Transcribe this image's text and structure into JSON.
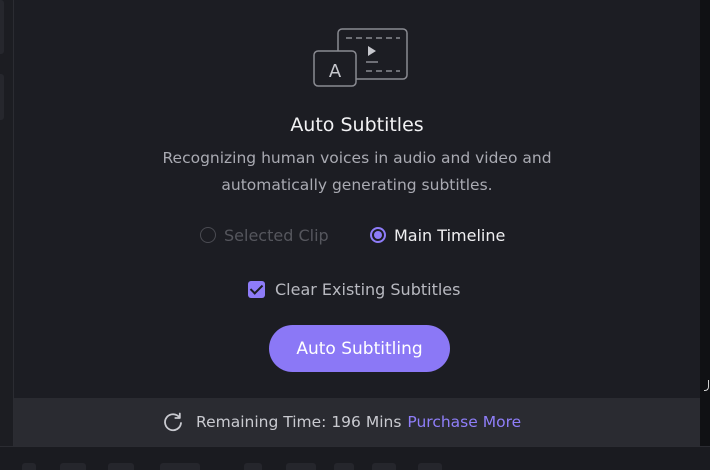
{
  "auto_subtitles": {
    "title": "Auto Subtitles",
    "description_line1": "Recognizing human voices in audio and video and",
    "description_line2": "automatically generating subtitles.",
    "options": {
      "selected_clip_label": "Selected Clip",
      "main_timeline_label": "Main Timeline",
      "selected": "Main Timeline"
    },
    "clear_existing": {
      "label": "Clear Existing Subtitles",
      "checked": true
    },
    "action_button_label": "Auto Subtitling",
    "footer": {
      "remaining_time_text": "Remaining Time: 196 Mins",
      "purchase_link_label": "Purchase More"
    }
  },
  "icons": {
    "hero": "subtitle-icon",
    "refresh": "refresh-icon"
  },
  "colors": {
    "accent": "#8b78f6",
    "panel_background": "#1c1d23",
    "footer_background": "#2a2b31",
    "link": "#8f7ef9"
  }
}
